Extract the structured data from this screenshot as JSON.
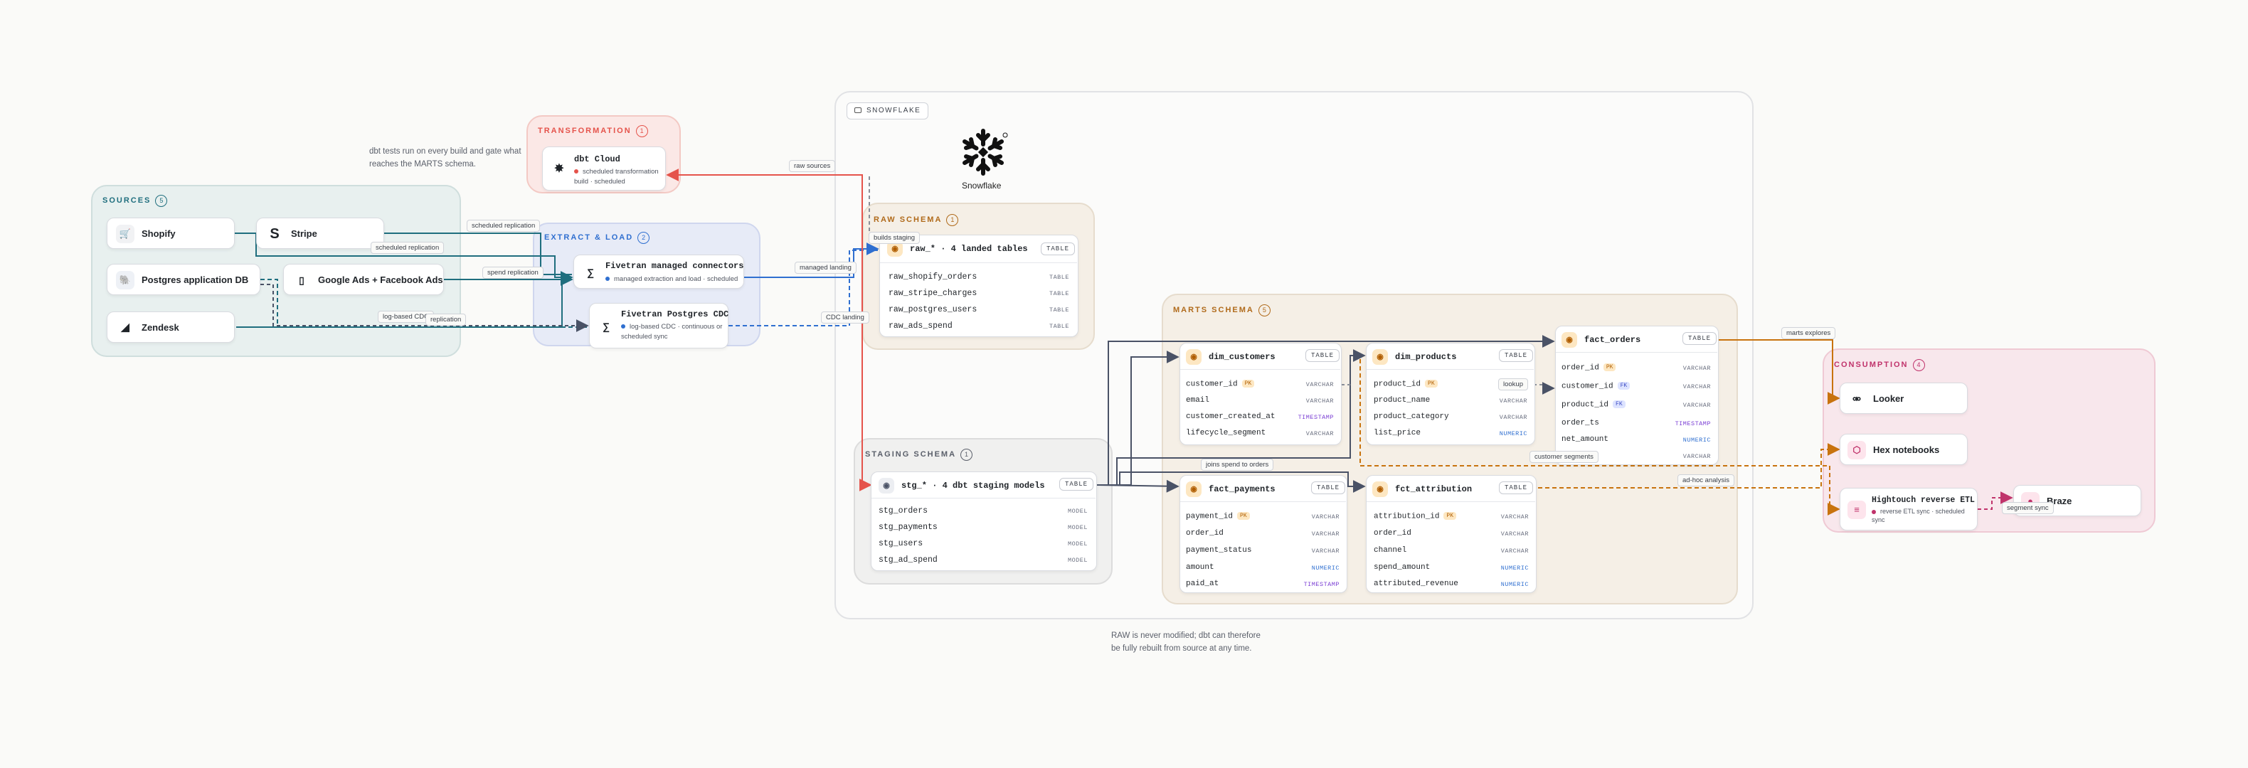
{
  "notes": {
    "dbt_tests_line1": "dbt tests run on every build and gate what",
    "dbt_tests_line2": "reaches the MARTS schema.",
    "raw_line1": "RAW is never modified; dbt can therefore",
    "raw_line2": "be fully rebuilt from source at any time."
  },
  "groups": {
    "sources": {
      "label": "SOURCES",
      "count": "5"
    },
    "transformation": {
      "label": "TRANSFORMATION",
      "count": "1"
    },
    "extract_load": {
      "label": "EXTRACT & LOAD",
      "count": "2"
    },
    "snowflake": {
      "label": "SNOWFLAKE",
      "logo_text": "Snowflake"
    },
    "raw_schema": {
      "label": "RAW SCHEMA",
      "count": "1"
    },
    "staging_schema": {
      "label": "STAGING SCHEMA",
      "count": "1"
    },
    "marts_schema": {
      "label": "MARTS SCHEMA",
      "count": "5"
    },
    "consumption": {
      "label": "CONSUMPTION",
      "count": "4"
    }
  },
  "sources": {
    "shopify": "Shopify",
    "stripe": "Stripe",
    "postgres": "Postgres application DB",
    "google_ads": "Google Ads + Facebook Ads",
    "zendesk": "Zendesk"
  },
  "dbt_cloud": {
    "title": "dbt Cloud",
    "sub1": "scheduled transformation",
    "sub2": "build · scheduled"
  },
  "fivetran_managed": {
    "title": "Fivetran managed connectors",
    "sub": "managed extraction and load · scheduled"
  },
  "fivetran_cdc": {
    "title": "Fivetran Postgres CDC",
    "sub1": "log-based CDC · continuous or",
    "sub2": "scheduled sync"
  },
  "raw_table": {
    "title": "raw_* · 4 landed tables",
    "tag": "TABLE",
    "rows": [
      {
        "name": "raw_shopify_orders",
        "type": "TABLE"
      },
      {
        "name": "raw_stripe_charges",
        "type": "TABLE"
      },
      {
        "name": "raw_postgres_users",
        "type": "TABLE"
      },
      {
        "name": "raw_ads_spend",
        "type": "TABLE"
      }
    ]
  },
  "stg_table": {
    "title": "stg_* · 4 dbt staging models",
    "tag": "TABLE",
    "rows": [
      {
        "name": "stg_orders",
        "type": "MODEL"
      },
      {
        "name": "stg_payments",
        "type": "MODEL"
      },
      {
        "name": "stg_users",
        "type": "MODEL"
      },
      {
        "name": "stg_ad_spend",
        "type": "MODEL"
      }
    ]
  },
  "dim_customers": {
    "title": "dim_customers",
    "tag": "TABLE",
    "rows": [
      {
        "name": "customer_id",
        "key": "PK",
        "type": "VARCHAR"
      },
      {
        "name": "email",
        "key": "",
        "type": "VARCHAR"
      },
      {
        "name": "customer_created_at",
        "key": "",
        "type": "TIMESTAMP"
      },
      {
        "name": "lifecycle_segment",
        "key": "",
        "type": "VARCHAR"
      }
    ]
  },
  "dim_products": {
    "title": "dim_products",
    "tag": "TABLE",
    "rows": [
      {
        "name": "product_id",
        "key": "PK",
        "type": "VARCHAR"
      },
      {
        "name": "product_name",
        "key": "",
        "type": "VARCHAR"
      },
      {
        "name": "product_category",
        "key": "",
        "type": "VARCHAR"
      },
      {
        "name": "list_price",
        "key": "",
        "type": "NUMERIC"
      }
    ]
  },
  "fact_orders": {
    "title": "fact_orders",
    "tag": "TABLE",
    "rows": [
      {
        "name": "order_id",
        "key": "PK",
        "type": "VARCHAR"
      },
      {
        "name": "customer_id",
        "key": "FK",
        "type": "VARCHAR"
      },
      {
        "name": "product_id",
        "key": "FK",
        "type": "VARCHAR"
      },
      {
        "name": "order_ts",
        "key": "",
        "type": "TIMESTAMP"
      },
      {
        "name": "net_amount",
        "key": "",
        "type": "NUMERIC"
      },
      {
        "name": "status",
        "key": "",
        "type": "VARCHAR"
      }
    ]
  },
  "fact_payments": {
    "title": "fact_payments",
    "tag": "TABLE",
    "rows": [
      {
        "name": "payment_id",
        "key": "PK",
        "type": "VARCHAR"
      },
      {
        "name": "order_id",
        "key": "",
        "type": "VARCHAR"
      },
      {
        "name": "payment_status",
        "key": "",
        "type": "VARCHAR"
      },
      {
        "name": "amount",
        "key": "",
        "type": "NUMERIC"
      },
      {
        "name": "paid_at",
        "key": "",
        "type": "TIMESTAMP"
      }
    ]
  },
  "fct_attribution": {
    "title": "fct_attribution",
    "tag": "TABLE",
    "rows": [
      {
        "name": "attribution_id",
        "key": "PK",
        "type": "VARCHAR"
      },
      {
        "name": "order_id",
        "key": "",
        "type": "VARCHAR"
      },
      {
        "name": "channel",
        "key": "",
        "type": "VARCHAR"
      },
      {
        "name": "spend_amount",
        "key": "",
        "type": "NUMERIC"
      },
      {
        "name": "attributed_revenue",
        "key": "",
        "type": "NUMERIC"
      }
    ]
  },
  "consumption": {
    "looker": "Looker",
    "hex": "Hex notebooks",
    "hightouch": {
      "title": "Hightouch reverse ETL",
      "sub1": "reverse ETL sync · scheduled",
      "sub2": "sync"
    },
    "braze": "Braze"
  },
  "edges": {
    "scheduled_replication_1": "scheduled replication",
    "scheduled_replication_2": "scheduled replication",
    "spend_replication": "spend replication",
    "log_based_cdc": "log-based CDC",
    "replication": "replication",
    "managed_landing": "managed landing",
    "cdc_landing": "CDC landing",
    "raw_sources": "raw sources",
    "builds_staging": "builds staging",
    "marts_explores": "marts explores",
    "joins_spend": "joins spend to orders",
    "customer_segments": "customer segments",
    "ad_hoc": "ad-hoc analysis",
    "segment_sync": "segment sync",
    "lookup": "lookup"
  },
  "colors": {
    "red": "#e5534b",
    "blue": "#2f6fd0",
    "teal": "#1f6e7e",
    "navy": "#4a5266",
    "orange": "#c8730e",
    "pink": "#c0336b",
    "gray": "#8a8f99"
  }
}
